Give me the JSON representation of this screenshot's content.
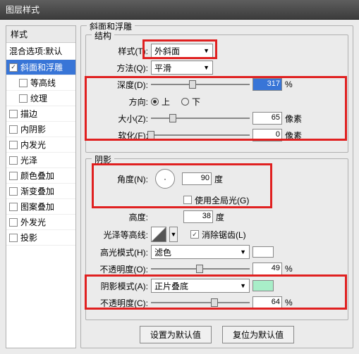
{
  "title": "图层样式",
  "left": {
    "header": "样式",
    "mix": "混合选项:默认",
    "items": [
      {
        "label": "斜面和浮雕",
        "checked": true,
        "selected": true,
        "child": false
      },
      {
        "label": "等高线",
        "checked": false,
        "selected": false,
        "child": true
      },
      {
        "label": "纹理",
        "checked": false,
        "selected": false,
        "child": true
      },
      {
        "label": "描边",
        "checked": false,
        "selected": false,
        "child": false
      },
      {
        "label": "内阴影",
        "checked": false,
        "selected": false,
        "child": false
      },
      {
        "label": "内发光",
        "checked": false,
        "selected": false,
        "child": false
      },
      {
        "label": "光泽",
        "checked": false,
        "selected": false,
        "child": false
      },
      {
        "label": "颜色叠加",
        "checked": false,
        "selected": false,
        "child": false
      },
      {
        "label": "渐变叠加",
        "checked": false,
        "selected": false,
        "child": false
      },
      {
        "label": "图案叠加",
        "checked": false,
        "selected": false,
        "child": false
      },
      {
        "label": "外发光",
        "checked": false,
        "selected": false,
        "child": false
      },
      {
        "label": "投影",
        "checked": false,
        "selected": false,
        "child": false
      }
    ]
  },
  "main": {
    "section_title": "斜面和浮雕",
    "structure": {
      "title": "结构",
      "style_label": "样式(T):",
      "style_value": "外斜面",
      "method_label": "方法(Q):",
      "method_value": "平滑",
      "depth_label": "深度(D):",
      "depth_value": "317",
      "depth_unit": "%",
      "direction_label": "方向:",
      "up": "上",
      "down": "下",
      "size_label": "大小(Z):",
      "size_value": "65",
      "size_unit": "像素",
      "soften_label": "软化(F):",
      "soften_value": "0",
      "soften_unit": "像素"
    },
    "shadow": {
      "title": "阴影",
      "angle_label": "角度(N):",
      "angle_value": "90",
      "angle_unit": "度",
      "global_label": "使用全局光(G)",
      "altitude_label": "高度:",
      "altitude_value": "38",
      "altitude_unit": "度",
      "gloss_label": "光泽等高线:",
      "antialias_label": "消除锯齿(L)",
      "highlight_mode_label": "高光模式(H):",
      "highlight_mode_value": "滤色",
      "highlight_color": "#ffffff",
      "highlight_op_label": "不透明度(O):",
      "highlight_op_value": "49",
      "highlight_op_unit": "%",
      "shadow_mode_label": "阴影模式(A):",
      "shadow_mode_value": "正片叠底",
      "shadow_color": "#a8eec8",
      "shadow_op_label": "不透明度(C):",
      "shadow_op_value": "64",
      "shadow_op_unit": "%"
    },
    "set_default": "设置为默认值",
    "reset_default": "复位为默认值"
  },
  "chart_data": {
    "type": "table",
    "title": "斜面和浮雕 参数",
    "rows": [
      {
        "param": "样式",
        "value": "外斜面"
      },
      {
        "param": "方法",
        "value": "平滑"
      },
      {
        "param": "深度",
        "value": 317,
        "unit": "%"
      },
      {
        "param": "方向",
        "value": "上"
      },
      {
        "param": "大小",
        "value": 65,
        "unit": "像素"
      },
      {
        "param": "软化",
        "value": 0,
        "unit": "像素"
      },
      {
        "param": "角度",
        "value": 90,
        "unit": "度"
      },
      {
        "param": "使用全局光",
        "value": false
      },
      {
        "param": "高度",
        "value": 38,
        "unit": "度"
      },
      {
        "param": "消除锯齿",
        "value": true
      },
      {
        "param": "高光模式",
        "value": "滤色"
      },
      {
        "param": "高光不透明度",
        "value": 49,
        "unit": "%"
      },
      {
        "param": "阴影模式",
        "value": "正片叠底"
      },
      {
        "param": "阴影不透明度",
        "value": 64,
        "unit": "%"
      }
    ]
  }
}
